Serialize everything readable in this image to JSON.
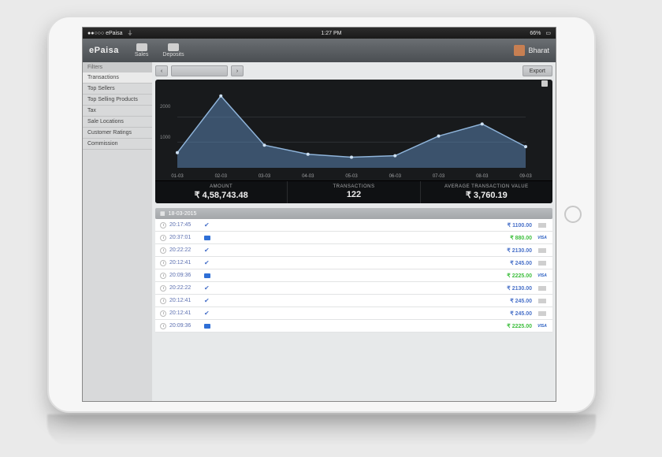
{
  "status_bar": {
    "carrier": "●●○○○ ePaisa",
    "wifi": "⏚",
    "time": "1:27 PM",
    "battery_pct": "66%",
    "battery_icon": "▭"
  },
  "header": {
    "brand": "ePaisa",
    "items": [
      {
        "icon": "sales-icon",
        "label": "Sales"
      },
      {
        "icon": "deposits-icon",
        "label": "Deposits"
      }
    ],
    "user": "Bharat"
  },
  "sidebar": {
    "title": "Filters",
    "items": [
      "Transactions",
      "Top Sellers",
      "Top Selling Products",
      "Tax",
      "Sale Locations",
      "Customer Ratings",
      "Commission"
    ],
    "active_index": 0
  },
  "toolbar": {
    "prev": "‹",
    "next": "›",
    "range": "",
    "export": "Export"
  },
  "chart_data": {
    "type": "area",
    "categories": [
      "01-03",
      "02-03",
      "03-03",
      "04-03",
      "05-03",
      "06-03",
      "07-03",
      "08-03",
      "09-03"
    ],
    "values": [
      0.2,
      0.95,
      0.3,
      0.18,
      0.14,
      0.16,
      0.42,
      0.58,
      0.28
    ],
    "y_ticks": [
      "1000",
      "2000"
    ],
    "title": "",
    "xlabel": "",
    "ylabel": "",
    "ylim": [
      0,
      1
    ]
  },
  "kpis": [
    {
      "label": "AMOUNT",
      "value": "₹ 4,58,743.48"
    },
    {
      "label": "TRANSACTIONS",
      "value": "122"
    },
    {
      "label": "AVERAGE TRANSACTION VALUE",
      "value": "₹ 3,760.19"
    }
  ],
  "transactions": {
    "date": "18-03-2015",
    "rows": [
      {
        "time": "20:17:45",
        "status": "check",
        "amount": "₹ 1100.00",
        "amount_color": "blue",
        "method": "cash"
      },
      {
        "time": "20:37:01",
        "status": "flag",
        "amount": "₹ 880.00",
        "amount_color": "green",
        "method": "visa"
      },
      {
        "time": "20:22:22",
        "status": "check",
        "amount": "₹ 2130.00",
        "amount_color": "blue",
        "method": "cash"
      },
      {
        "time": "20:12:41",
        "status": "check",
        "amount": "₹ 245.00",
        "amount_color": "blue",
        "method": "cash"
      },
      {
        "time": "20:09:36",
        "status": "flag",
        "amount": "₹ 2225.00",
        "amount_color": "green",
        "method": "visa"
      },
      {
        "time": "20:22:22",
        "status": "check",
        "amount": "₹ 2130.00",
        "amount_color": "blue",
        "method": "cash"
      },
      {
        "time": "20:12:41",
        "status": "check",
        "amount": "₹ 245.00",
        "amount_color": "blue",
        "method": "cash"
      },
      {
        "time": "20:12:41",
        "status": "check",
        "amount": "₹ 245.00",
        "amount_color": "blue",
        "method": "cash"
      },
      {
        "time": "20:09:36",
        "status": "flag",
        "amount": "₹ 2225.00",
        "amount_color": "green",
        "method": "visa"
      }
    ]
  }
}
